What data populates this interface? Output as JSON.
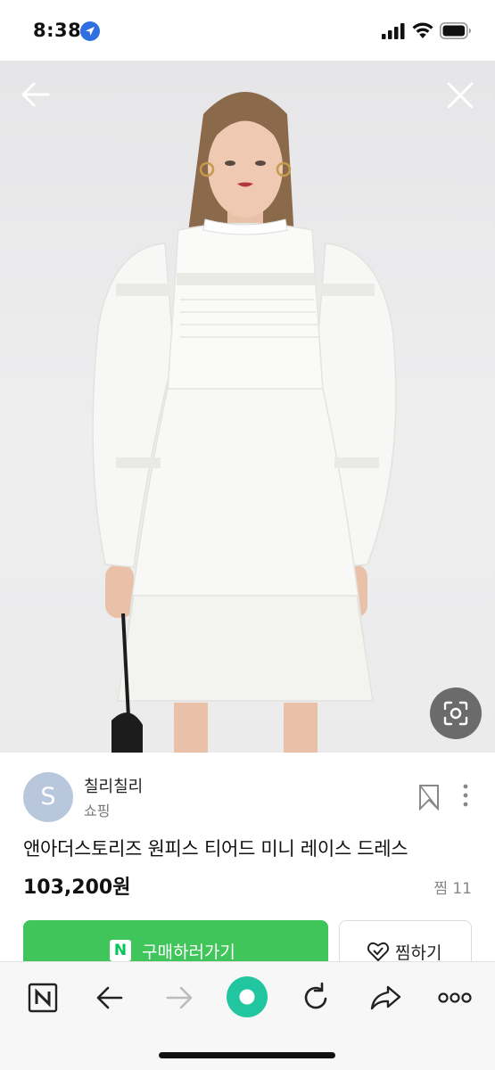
{
  "status_bar": {
    "time": "8:38",
    "icons": [
      "location-arrow-icon",
      "cellular-signal-icon",
      "wifi-icon",
      "battery-icon"
    ]
  },
  "hero": {
    "icons": [
      "back-arrow-icon",
      "close-icon",
      "image-search-lens-icon"
    ]
  },
  "seller": {
    "avatar_letter": "S",
    "name": "칠리칠리",
    "category": "쇼핑",
    "avatar_color": "#b9c7dc"
  },
  "product": {
    "title": "앤아더스토리즈 원피스 티어드 미니 레이스 드레스",
    "price": "103,200원",
    "zzim_count": "찜 11"
  },
  "actions": {
    "buy_badge": "N",
    "buy_label": "구매하러가기",
    "zzim_label": "찜하기",
    "buy_color": "#3fc55a"
  },
  "toolbar": {
    "items": [
      "naver-n-icon",
      "back-icon",
      "forward-icon",
      "home-icon",
      "reload-icon",
      "share-icon",
      "more-icon"
    ],
    "home_color": "#21c6a0"
  }
}
